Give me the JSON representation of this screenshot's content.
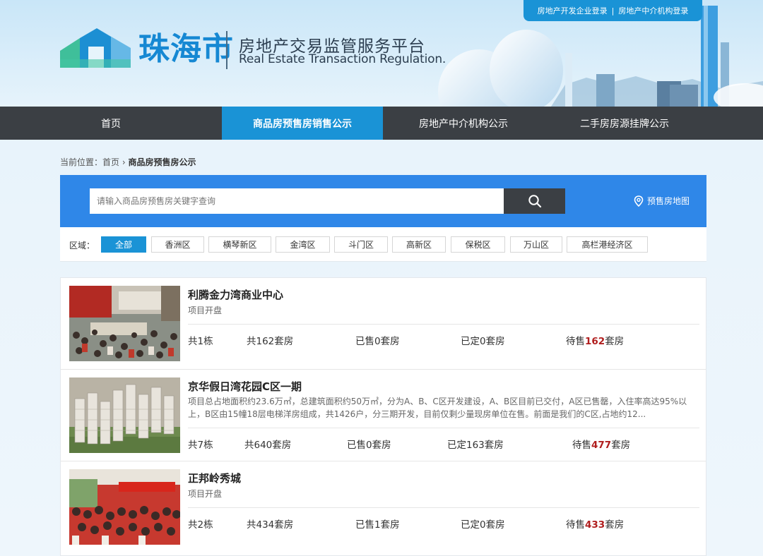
{
  "header": {
    "developer_login": "房地产开发企业登录",
    "separator": "|",
    "agency_login": "房地产中介机构登录",
    "city_name": "珠海市",
    "platform_cn": "房地产交易监管服务平台",
    "platform_en": "Real Estate Transaction Regulation."
  },
  "nav": {
    "items": [
      {
        "label": "首页"
      },
      {
        "label": "商品房预售房销售公示"
      },
      {
        "label": "房地产中介机构公示"
      },
      {
        "label": "二手房房源挂牌公示"
      }
    ],
    "active_index": 1
  },
  "breadcrumb": {
    "prefix": "当前位置：",
    "home": "首页",
    "arrow": "›",
    "current": "商品房预售房公示"
  },
  "search": {
    "placeholder": "请输入商品房预售房关键字查询",
    "map_label": "预售房地图"
  },
  "filter": {
    "label": "区域：",
    "tags": [
      "全部",
      "香洲区",
      "横琴新区",
      "金湾区",
      "斗门区",
      "高新区",
      "保税区",
      "万山区",
      "高栏港经济区"
    ],
    "active_index": 0
  },
  "listings": [
    {
      "title": "利腾金力湾商业中心",
      "description": "项目开盘",
      "buildings": "共1栋",
      "total": "共162套房",
      "sold": "已售0套房",
      "reserved": "已定0套房",
      "available_prefix": "待售",
      "available_num": "162",
      "available_suffix": "套房"
    },
    {
      "title": "京华假日湾花园C区一期",
      "description": "项目总占地面积约23.6万㎡，总建筑面积约50万㎡，分为A、B、C区开发建设，A、B区目前已交付，A区已售罄，入住率高达95%以上，B区由15幢18层电梯洋房组成，共1426户，分三期开发，目前仅剩少量现房单位在售。前面是我们的C区,占地约12...",
      "buildings": "共7栋",
      "total": "共640套房",
      "sold": "已售0套房",
      "reserved": "已定163套房",
      "available_prefix": "待售",
      "available_num": "477",
      "available_suffix": "套房"
    },
    {
      "title": "正邦岭秀城",
      "description": "项目开盘",
      "buildings": "共2栋",
      "total": "共434套房",
      "sold": "已售1套房",
      "reserved": "已定0套房",
      "available_prefix": "待售",
      "available_num": "433",
      "available_suffix": "套房"
    }
  ],
  "colors": {
    "brand_blue": "#1a93d6",
    "search_blue": "#2f87e8",
    "nav_dark": "#3b3f44",
    "highlight_red": "#b01e1e"
  }
}
